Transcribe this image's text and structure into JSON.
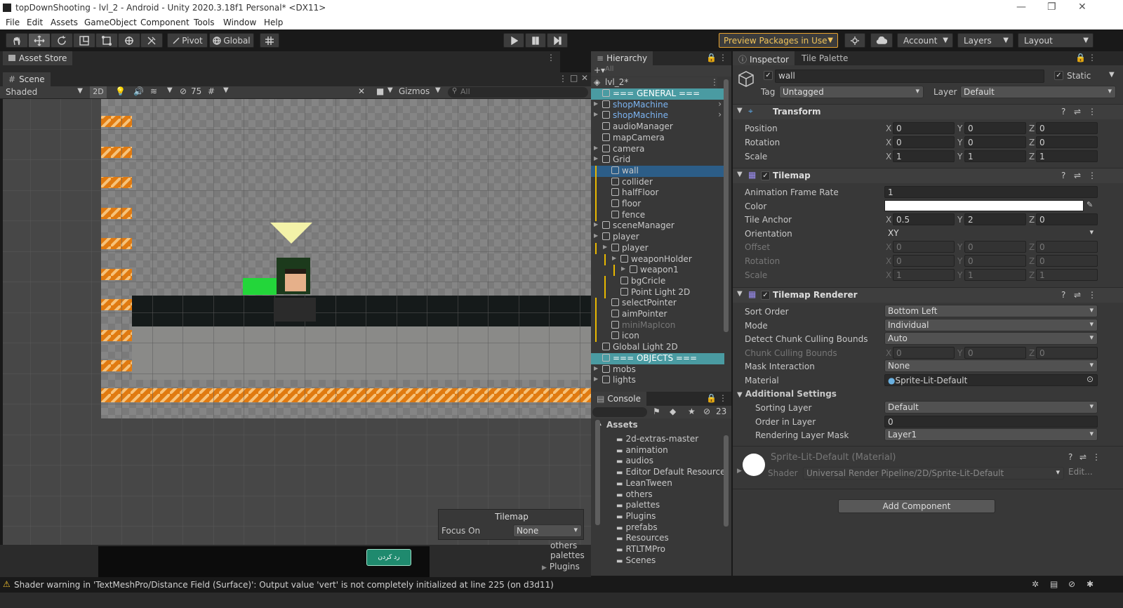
{
  "window": {
    "title": "topDownShooting - lvl_2 - Android - Unity 2020.3.18f1 Personal* <DX11>",
    "controls": [
      "—",
      "❐",
      "✕"
    ]
  },
  "menu": [
    "File",
    "Edit",
    "Assets",
    "GameObject",
    "Component",
    "Tools",
    "Window",
    "Help"
  ],
  "toolbar": {
    "pivot": "Pivot",
    "global": "Global",
    "preview_packages": "Preview Packages in Use",
    "account": "Account",
    "layers": "Layers",
    "layout": "Layout"
  },
  "asset_store_tab": "Asset Store",
  "scene": {
    "tab": "Scene",
    "shading": "Shaded",
    "mode_2d": "2D",
    "hidden_count": "75",
    "gizmos": "Gizmos",
    "search_placeholder": "All",
    "overlay": {
      "title": "Tilemap",
      "focus_label": "Focus On",
      "focus_value": "None"
    },
    "button_text": "رد کردن"
  },
  "hierarchy": {
    "tab": "Hierarchy",
    "search_placeholder": "All",
    "scene_name": "lvl_2*",
    "items": [
      {
        "label": "=== GENERAL ===",
        "indent": 0,
        "style": "hl",
        "arrow": false
      },
      {
        "label": "shopMachine",
        "indent": 0,
        "style": "prefab",
        "arrow": true
      },
      {
        "label": "shopMachine",
        "indent": 0,
        "style": "prefab",
        "arrow": true
      },
      {
        "label": "audioManager",
        "indent": 0,
        "style": "",
        "arrow": false
      },
      {
        "label": "mapCamera",
        "indent": 0,
        "style": "",
        "arrow": false
      },
      {
        "label": "camera",
        "indent": 0,
        "style": "",
        "arrow": true
      },
      {
        "label": "Grid",
        "indent": 0,
        "style": "",
        "arrow": true
      },
      {
        "label": "wall",
        "indent": 1,
        "style": "sel",
        "arrow": false
      },
      {
        "label": "collider",
        "indent": 1,
        "style": "",
        "arrow": false
      },
      {
        "label": "halfFloor",
        "indent": 1,
        "style": "",
        "arrow": false
      },
      {
        "label": "floor",
        "indent": 1,
        "style": "",
        "arrow": false
      },
      {
        "label": "fence",
        "indent": 1,
        "style": "",
        "arrow": false
      },
      {
        "label": "sceneManager",
        "indent": 0,
        "style": "",
        "arrow": true
      },
      {
        "label": "player",
        "indent": 0,
        "style": "",
        "arrow": true
      },
      {
        "label": "player",
        "indent": 1,
        "style": "",
        "arrow": true
      },
      {
        "label": "weaponHolder",
        "indent": 2,
        "style": "",
        "arrow": true
      },
      {
        "label": "weapon1",
        "indent": 3,
        "style": "",
        "arrow": true
      },
      {
        "label": "bgCricle",
        "indent": 2,
        "style": "",
        "arrow": false
      },
      {
        "label": "Point Light 2D",
        "indent": 2,
        "style": "",
        "arrow": false
      },
      {
        "label": "selectPointer",
        "indent": 1,
        "style": "",
        "arrow": false
      },
      {
        "label": "aimPointer",
        "indent": 1,
        "style": "",
        "arrow": false
      },
      {
        "label": "miniMapIcon",
        "indent": 1,
        "style": "dim",
        "arrow": false
      },
      {
        "label": "icon",
        "indent": 1,
        "style": "",
        "arrow": false
      },
      {
        "label": "Global Light 2D",
        "indent": 0,
        "style": "",
        "arrow": false
      },
      {
        "label": "=== OBJECTS ===",
        "indent": 0,
        "style": "hl",
        "arrow": false
      },
      {
        "label": "mobs",
        "indent": 0,
        "style": "",
        "arrow": true
      },
      {
        "label": "lights",
        "indent": 0,
        "style": "",
        "arrow": true
      }
    ]
  },
  "console": {
    "tab": "Console",
    "count": "23",
    "assets_header": "Assets",
    "folders": [
      "2d-extras-master",
      "animation",
      "audios",
      "Editor Default Resources",
      "LeanTween",
      "others",
      "palettes",
      "Plugins",
      "prefabs",
      "Resources",
      "RTLTMPro",
      "Scenes"
    ]
  },
  "under_panel": {
    "folders": [
      "others",
      "palettes",
      "Plugins"
    ]
  },
  "inspector": {
    "tab": "Inspector",
    "tab2": "Tile Palette",
    "object_name": "wall",
    "static_label": "Static",
    "tag_label": "Tag",
    "tag_value": "Untagged",
    "layer_label": "Layer",
    "layer_value": "Default",
    "transform": {
      "title": "Transform",
      "position": {
        "label": "Position",
        "x": "0",
        "y": "0",
        "z": "0"
      },
      "rotation": {
        "label": "Rotation",
        "x": "0",
        "y": "0",
        "z": "0"
      },
      "scale": {
        "label": "Scale",
        "x": "1",
        "y": "1",
        "z": "1"
      }
    },
    "tilemap": {
      "title": "Tilemap",
      "frame_rate_label": "Animation Frame Rate",
      "frame_rate": "1",
      "color_label": "Color",
      "color": "#ffffff",
      "anchor_label": "Tile Anchor",
      "anchor_x": "0.5",
      "anchor_y": "2",
      "anchor_z": "0",
      "orientation_label": "Orientation",
      "orientation": "XY",
      "offset_label": "Offset",
      "offset": [
        "0",
        "0",
        "0"
      ],
      "rotation_label": "Rotation",
      "rotation": [
        "0",
        "0",
        "0"
      ],
      "scale_label": "Scale",
      "scale": [
        "1",
        "1",
        "1"
      ]
    },
    "renderer": {
      "title": "Tilemap Renderer",
      "sort_order_label": "Sort Order",
      "sort_order": "Bottom Left",
      "mode_label": "Mode",
      "mode": "Individual",
      "culling_label": "Detect Chunk Culling Bounds",
      "culling": "Auto",
      "chunk_label": "Chunk Culling Bounds",
      "chunk": [
        "0",
        "0",
        "0"
      ],
      "mask_label": "Mask Interaction",
      "mask": "None",
      "material_label": "Material",
      "material": "Sprite-Lit-Default",
      "additional_label": "Additional Settings",
      "sorting_layer_label": "Sorting Layer",
      "sorting_layer": "Default",
      "order_label": "Order in Layer",
      "order": "0",
      "rendering_mask_label": "Rendering Layer Mask",
      "rendering_mask": "Layer1"
    },
    "material_block": {
      "name": "Sprite-Lit-Default (Material)",
      "shader_label": "Shader",
      "shader": "Universal Render Pipeline/2D/Sprite-Lit-Default",
      "edit": "Edit..."
    },
    "add_component": "Add Component"
  },
  "status": {
    "message": "Shader warning in 'TextMeshPro/Distance Field (Surface)': Output value 'vert' is not completely initialized at line 225 (on d3d11)"
  },
  "colors": {
    "accent_teal": "#4a9ba2",
    "prefab_blue": "#7cb4f2",
    "warning": "#f2c12e",
    "preview_border": "#e8a32e"
  }
}
